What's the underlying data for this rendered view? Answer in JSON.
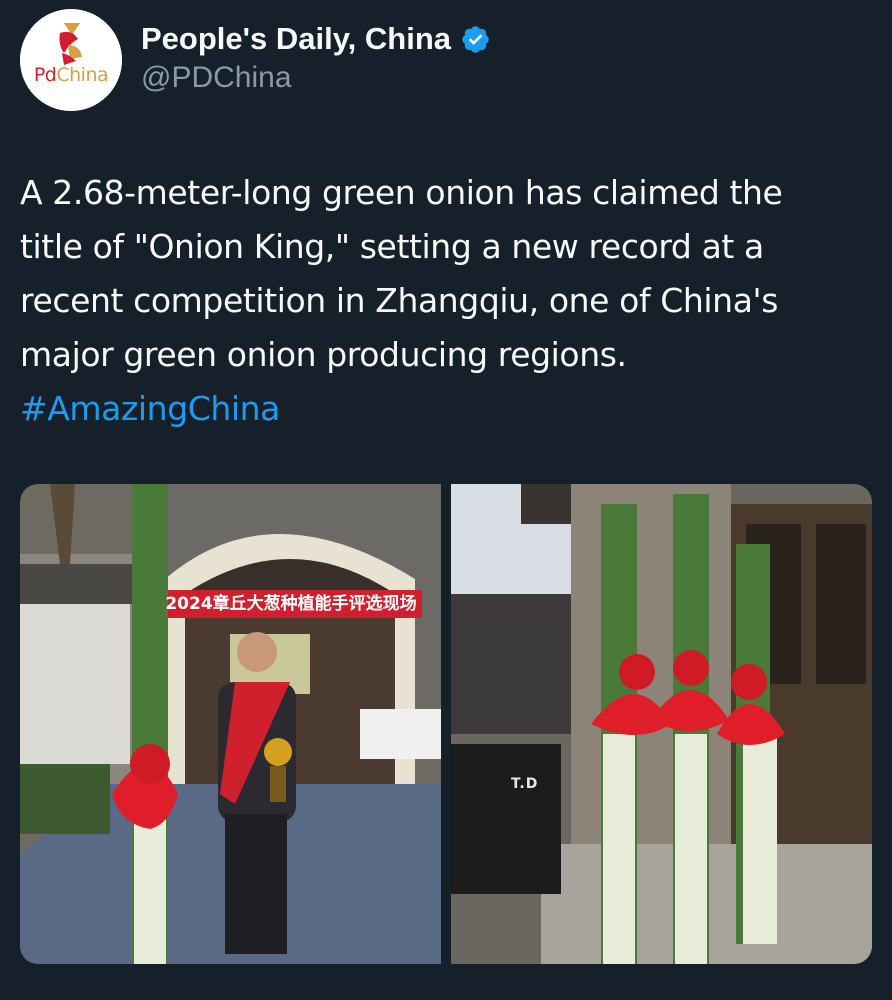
{
  "author": {
    "display_name": "People's Daily, China",
    "handle": "@PDChina",
    "avatar_text_pd": "Pd",
    "avatar_text_china": "China",
    "verified": true,
    "verified_color": "#1d9bf0"
  },
  "tweet": {
    "text_lines": [
      "A 2.68-meter-long green onion has claimed the",
      "title of \"Onion King,\" setting a new record at a",
      "recent competition in Zhangqiu, one of China's",
      "major green onion producing regions."
    ],
    "hashtag": "#AmazingChina"
  },
  "media": {
    "photo_1": {
      "banner_text": "2024章丘大葱种植能手评选现场"
    },
    "photo_2": {
      "case_label": "T.D"
    }
  },
  "colors": {
    "background": "#15202b",
    "text_primary": "#f7f9f9",
    "text_secondary": "#8b98a5",
    "link": "#1d9bf0"
  }
}
